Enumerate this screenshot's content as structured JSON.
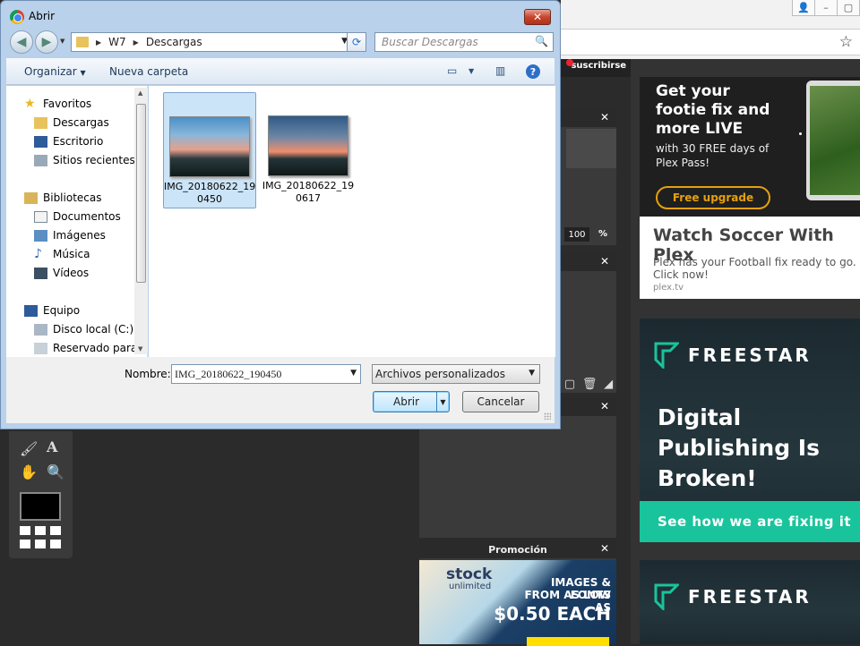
{
  "dialog": {
    "title": "Abrir",
    "close_glyph": "✕",
    "breadcrumb": [
      "W7",
      "Descargas"
    ],
    "search_placeholder": "Buscar Descargas",
    "toolbar": {
      "organize": "Organizar",
      "new_folder": "Nueva carpeta",
      "help": "?"
    },
    "tree": {
      "favorites": {
        "label": "Favoritos",
        "items": [
          "Descargas",
          "Escritorio",
          "Sitios recientes"
        ]
      },
      "libraries": {
        "label": "Bibliotecas",
        "items": [
          "Documentos",
          "Imágenes",
          "Música",
          "Vídeos"
        ]
      },
      "computer": {
        "label": "Equipo",
        "items": [
          "Disco local (C:)",
          "Reservado para e"
        ]
      }
    },
    "files": [
      {
        "name_line1": "IMG_20180622_19",
        "name_line2": "0450",
        "selected": true
      },
      {
        "name_line1": "IMG_20180622_19",
        "name_line2": "0617",
        "selected": false
      }
    ],
    "filename_label": "Nombre:",
    "filename_value": "IMG_20180622_190450",
    "filetype_value": "Archivos personalizados",
    "open_button": "Abrir",
    "cancel_button": "Cancelar"
  },
  "background": {
    "app_bar_text": "suscribirse",
    "zoom_value": "100",
    "zoom_unit": "%",
    "promo_panel_title": "Promoción",
    "panel_close": "✕",
    "stock_ad": {
      "logo": "stock",
      "logo_sub": "unlimited",
      "line1": "IMAGES & FONTS",
      "line2": "FROM AS LOW AS",
      "line3": "$0.50 EACH"
    },
    "plex_ad": {
      "headline": "Get your footie fix and more LIVE",
      "sub": "with 30 FREE days of Plex Pass!",
      "button": "Free upgrade",
      "title": "Watch Soccer With Plex",
      "desc": "Plex has your Football fix ready to go. Click now!",
      "link": "plex.tv"
    },
    "freestar_ad": {
      "logo": "FREESTAR",
      "headline": "Digital Publishing Is Broken!",
      "cta": "See how we are fixing it"
    },
    "freestar_ad2": {
      "logo": "FREESTAR"
    }
  },
  "colors": {
    "plex_orange": "#e5a00d",
    "freestar_green": "#19c49c",
    "dialog_frame": "#b9d1ea"
  }
}
